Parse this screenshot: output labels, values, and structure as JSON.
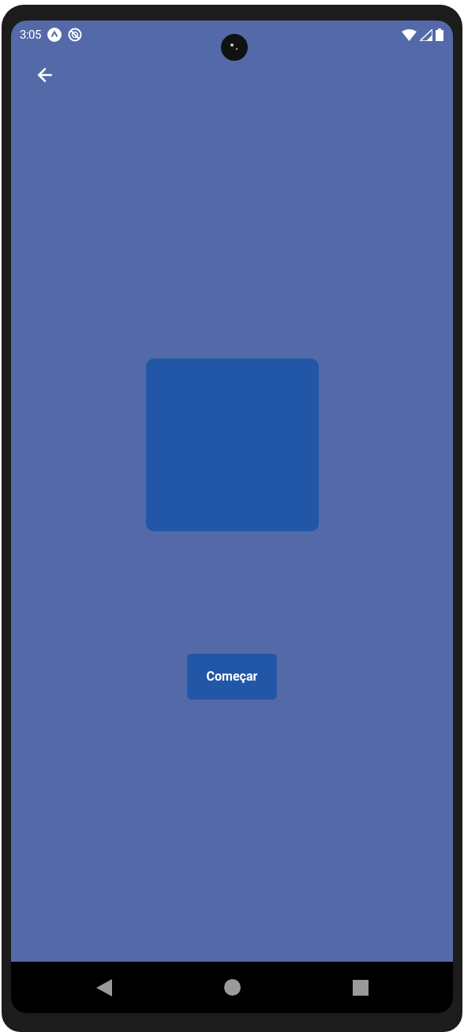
{
  "status_bar": {
    "time": "3:05"
  },
  "start_button": {
    "label": "Começar"
  }
}
